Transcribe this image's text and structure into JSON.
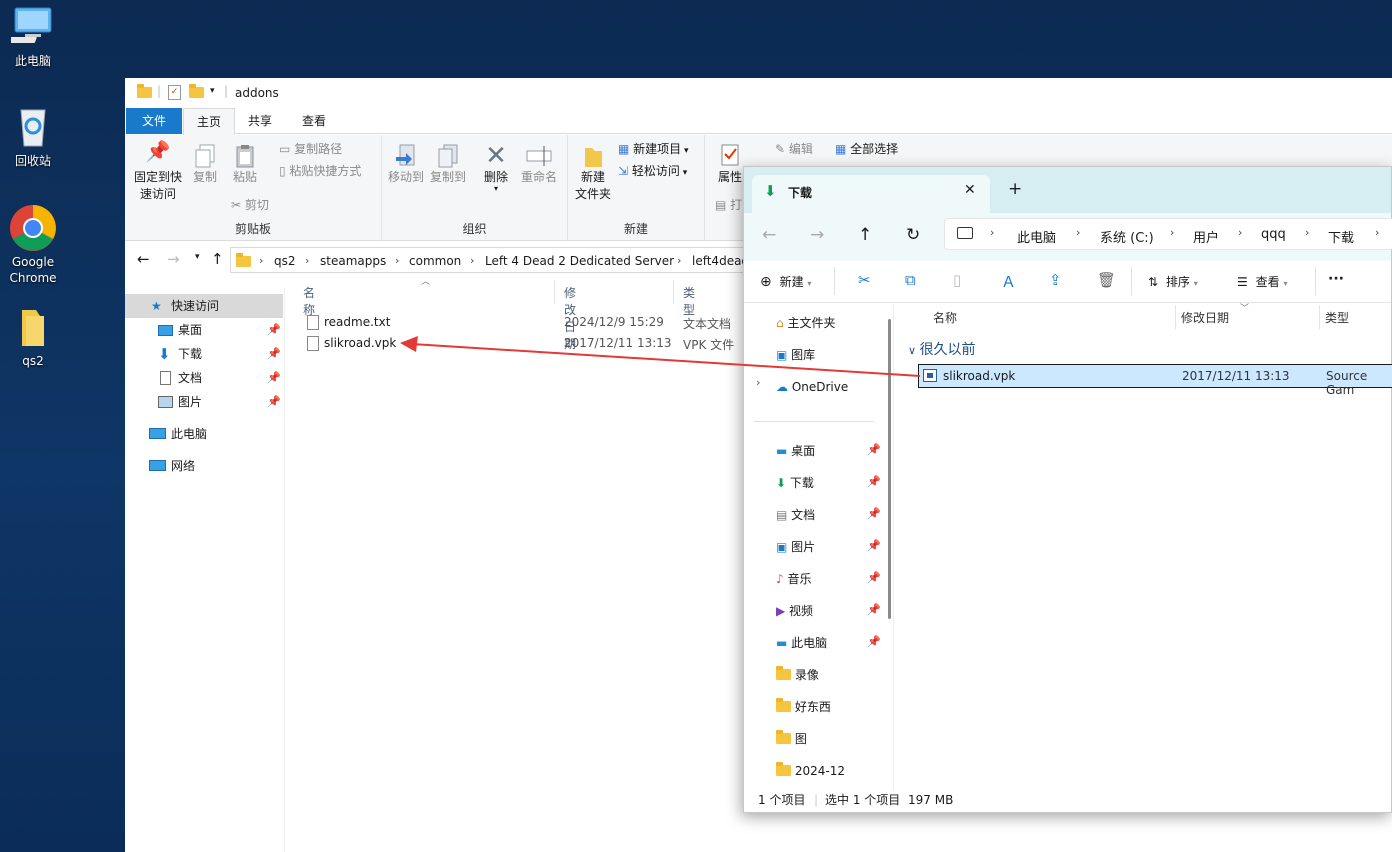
{
  "desktop": [
    {
      "label": "此电脑",
      "icon": "this-pc-icon"
    },
    {
      "label": "回收站",
      "icon": "recycle-bin-icon"
    },
    {
      "label": "Google Chrome",
      "icon": "chrome-icon"
    },
    {
      "label": "qs2",
      "icon": "folder-icon"
    }
  ],
  "win1": {
    "title": "addons",
    "tabs": {
      "file": "文件",
      "home": "主页",
      "share": "共享",
      "view": "查看"
    },
    "clipboard": {
      "pin": "固定到快速访问",
      "copy": "复制",
      "paste": "粘贴",
      "copy_path": "复制路径",
      "paste_shortcut": "粘贴快捷方式",
      "cut": "剪切",
      "label": "剪贴板"
    },
    "organize": {
      "move_to": "移动到",
      "copy_to": "复制到",
      "delete": "删除",
      "rename": "重命名",
      "label": "组织"
    },
    "new": {
      "new_folder": "新建\n文件夹",
      "new_item": "新建项目",
      "easy_access": "轻松访问",
      "label": "新建"
    },
    "open": {
      "properties": "属性",
      "open_short": "打"
    },
    "select": {
      "edit": "编辑",
      "select_all": "全部选择"
    },
    "path": [
      "qs2",
      "steamapps",
      "common",
      "Left 4 Dead 2 Dedicated Server",
      "left4dead"
    ],
    "nav": {
      "quick_access": "快速访问",
      "desktop": "桌面",
      "downloads": "下载",
      "documents": "文档",
      "pictures": "图片",
      "this_pc": "此电脑",
      "network": "网络"
    },
    "columns": {
      "name": "名称",
      "date": "修改日期",
      "type": "类型"
    },
    "files": [
      {
        "name": "readme.txt",
        "date": "2024/12/9 15:29",
        "type": "文本文档"
      },
      {
        "name": "slikroad.vpk",
        "date": "2017/12/11 13:13",
        "type": "VPK 文件"
      }
    ]
  },
  "win2": {
    "tab_title": "下载",
    "new_tab": "+",
    "path": [
      "此电脑",
      "系统 (C:)",
      "用户",
      "qqq",
      "下载"
    ],
    "cmd": {
      "new": "新建",
      "sort": "排序",
      "view": "查看",
      "more": "···"
    },
    "nav": {
      "home": "主文件夹",
      "gallery": "图库",
      "onedrive": "OneDrive",
      "desktop": "桌面",
      "downloads": "下载",
      "documents": "文档",
      "pictures": "图片",
      "music": "音乐",
      "videos": "视频",
      "this_pc": "此电脑",
      "recordings": "录像",
      "goodstuff": "好东西",
      "pics": "图",
      "dec": "2024-12"
    },
    "columns": {
      "name": "名称",
      "date": "修改日期",
      "type": "类型"
    },
    "group": "很久以前",
    "file": {
      "name": "slikroad.vpk",
      "date": "2017/12/11 13:13",
      "type": "Source Gam"
    },
    "status": {
      "count": "1 个项目",
      "selected": "选中 1 个项目",
      "size": "197 MB"
    }
  },
  "colors": {
    "accent": "#1979ca",
    "arrow": "#e53935",
    "selection": "#cce8ff",
    "tab_bar": "#d6eef1"
  }
}
